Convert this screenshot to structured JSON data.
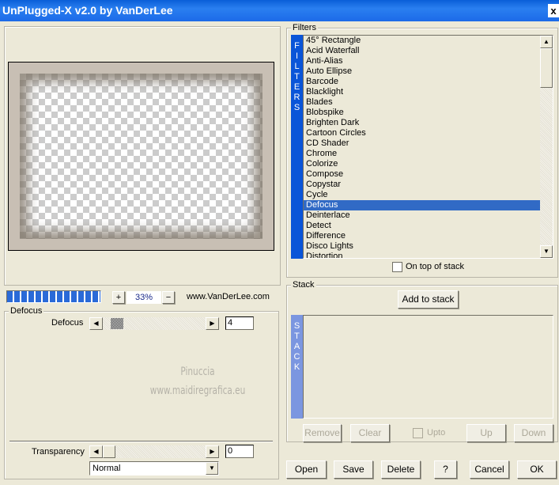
{
  "window": {
    "title": "UnPlugged-X v2.0 by VanDerLee",
    "close_label": "x"
  },
  "preview": {
    "zoom": "33%",
    "zoom_in": "+",
    "zoom_out": "−",
    "website": "www.VanDerLee.com",
    "progress_percent": 100
  },
  "parameters": {
    "group_title": "Defocus",
    "defocus": {
      "label": "Defocus",
      "value": "4"
    },
    "transparency": {
      "label": "Transparency",
      "value": "0"
    },
    "blend_mode": "Normal",
    "watermark": [
      "Pinuccia",
      "www.maidiregrafica.eu"
    ]
  },
  "filters": {
    "group_title": "Filters",
    "side_label": "FILTERS",
    "items": [
      "45° Rectangle",
      "Acid Waterfall",
      "Anti-Alias",
      "Auto Ellipse",
      "Barcode",
      "Blacklight",
      "Blades",
      "Blobspike",
      "Brighten Dark",
      "Cartoon Circles",
      "CD Shader",
      "Chrome",
      "Colorize",
      "Compose",
      "Copystar",
      "Cycle",
      "Defocus",
      "Deinterlace",
      "Detect",
      "Difference",
      "Disco Lights",
      "Distortion"
    ],
    "selected": "Defocus",
    "on_top_label": "On top of stack",
    "on_top_checked": false
  },
  "stack": {
    "group_title": "Stack",
    "side_label": "STACK",
    "add_label": "Add to stack",
    "remove": "Remove",
    "clear": "Clear",
    "upto": "Upto",
    "up": "Up",
    "down": "Down"
  },
  "footer": {
    "open": "Open",
    "save": "Save",
    "delete": "Delete",
    "help": "?",
    "cancel": "Cancel",
    "ok": "OK"
  },
  "colors": {
    "titlebar": "#0a5fd8",
    "selection": "#316ac5",
    "filters_bar": "#0a55d8",
    "stack_bar": "#7b96e0"
  }
}
